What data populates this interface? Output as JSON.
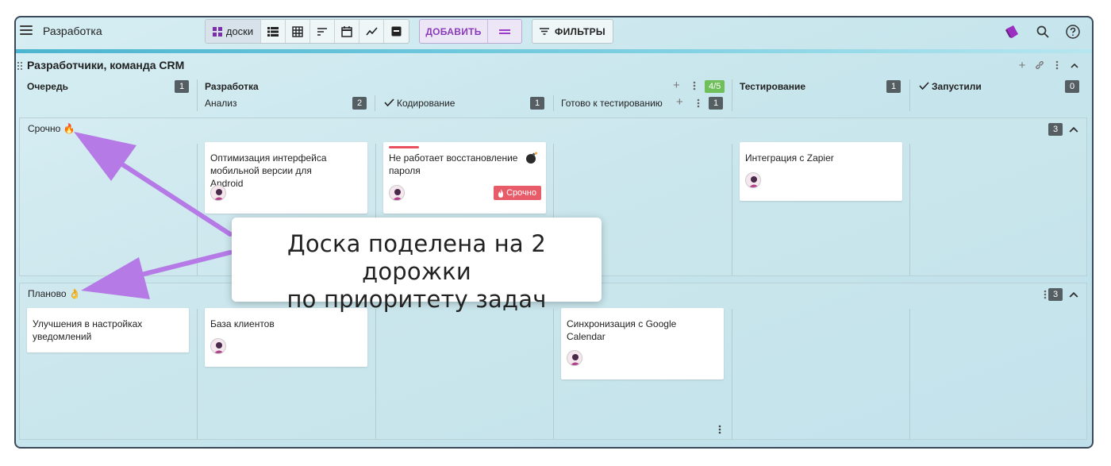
{
  "app": {
    "title": "Разработка"
  },
  "toolbar": {
    "boards_label": "доски",
    "add_label": "ДОБАВИТЬ",
    "filters_label": "ФИЛЬТРЫ",
    "view_icons": [
      "boards-icon",
      "list-icon",
      "table-icon",
      "gantt-icon",
      "calendar-icon",
      "chart-icon",
      "archive-icon"
    ],
    "right_icons": [
      "logo-icon",
      "search-icon",
      "help-icon"
    ]
  },
  "board": {
    "title": "Разработчики, команда CRM",
    "columns": [
      {
        "name": "Очередь",
        "count": "1"
      },
      {
        "name": "Разработка",
        "wip": "4/5",
        "sub": [
          {
            "name": "Анализ",
            "count": "2"
          },
          {
            "name": "Кодирование",
            "count": "1",
            "check": true
          },
          {
            "name": "Готово к тестированию",
            "count": "1"
          }
        ]
      },
      {
        "name": "Тестирование",
        "count": "1"
      },
      {
        "name": "Запустили",
        "count": "0",
        "check": true
      }
    ]
  },
  "lanes": [
    {
      "title": "Срочно",
      "emoji": "🔥",
      "count": "3",
      "cards": [
        {
          "title": "Оптимизация интерфейса мобильной версии для Android"
        },
        {
          "title": "Не работает восстановление пароля",
          "tag": "Срочно"
        },
        {
          "title": "Интеграция с Zapier"
        }
      ]
    },
    {
      "title": "Планово",
      "emoji": "👌",
      "count": "3",
      "cards": [
        {
          "title": "Улучшения в настройках уведомлений"
        },
        {
          "title": "База клиентов"
        },
        {
          "title": "Синхронизация с Google Calendar"
        }
      ]
    }
  ],
  "callout": {
    "line1": "Доска поделена на 2 дорожки",
    "line2": "по приоритету задач"
  },
  "colors": {
    "accent": "#8a3cb8",
    "urgent": "#e85c6a",
    "arrow": "#b57ae6",
    "wip": "#6fbf5a"
  }
}
